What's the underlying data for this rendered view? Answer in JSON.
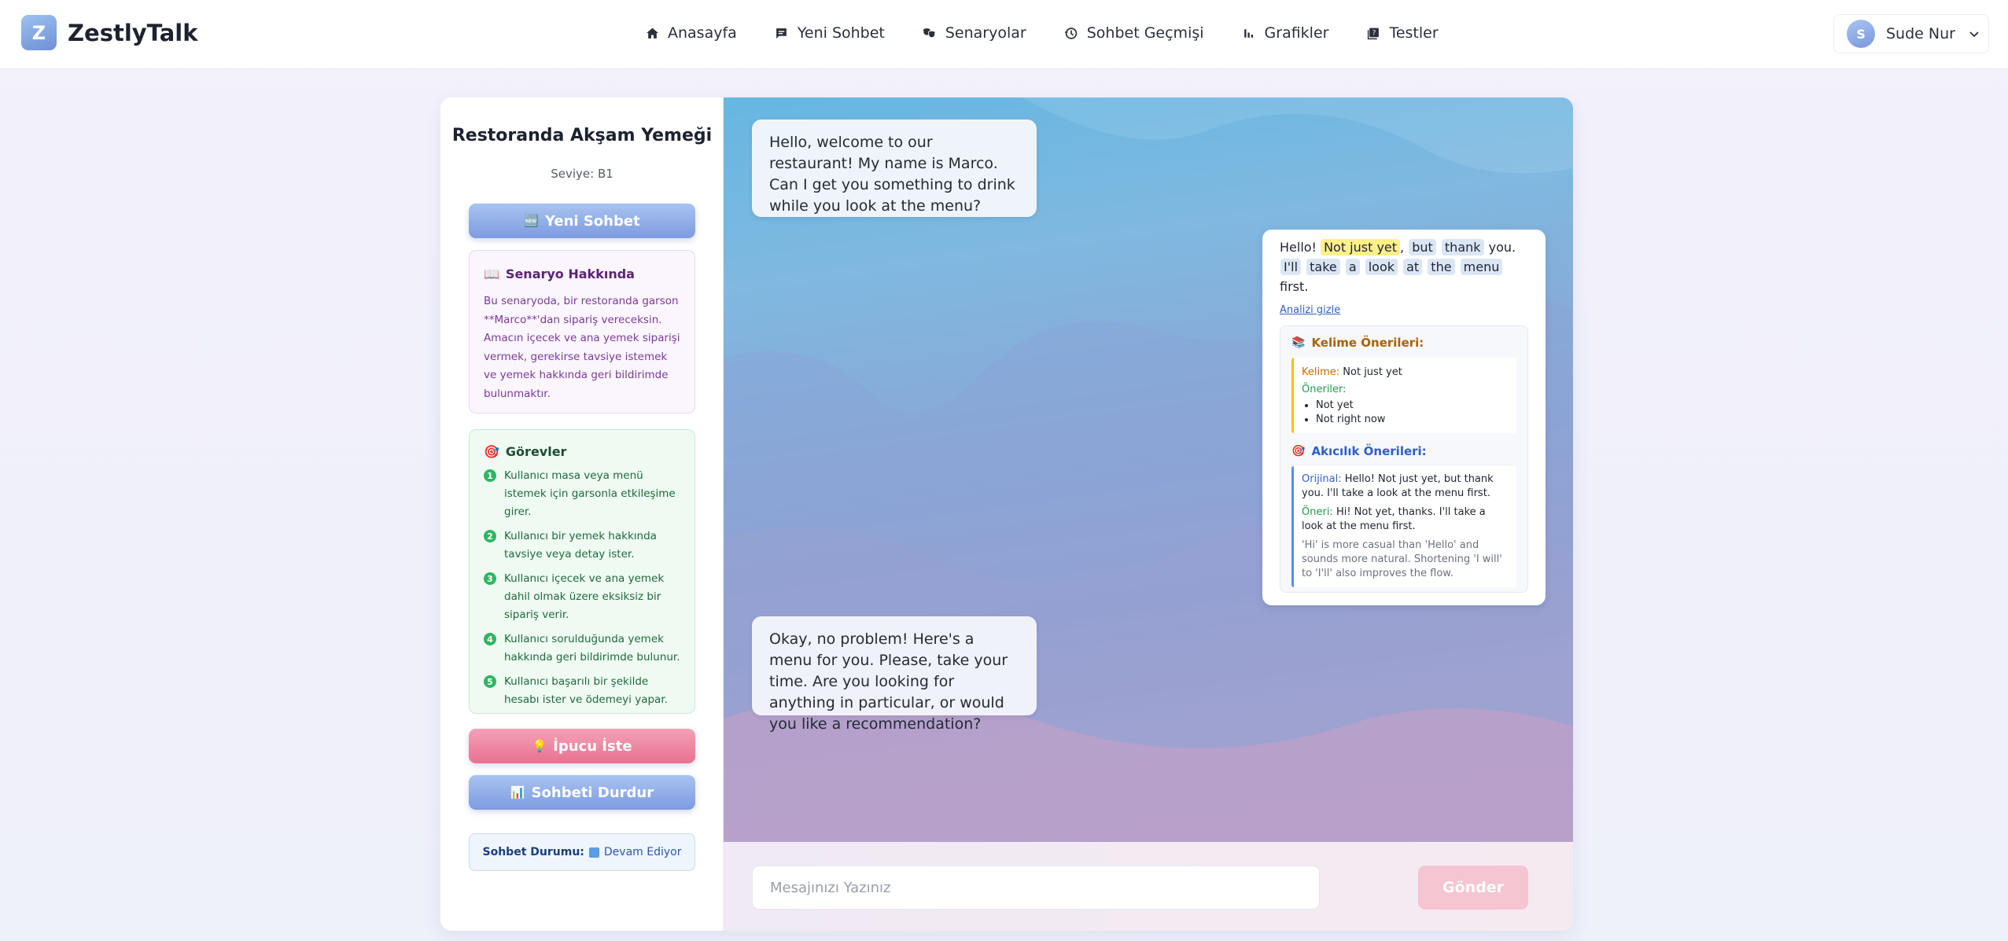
{
  "app": {
    "logo_letter": "Z",
    "name": "ZestlyTalk"
  },
  "nav": {
    "items": [
      {
        "label": "Anasayfa",
        "icon": "home-icon"
      },
      {
        "label": "Yeni Sohbet",
        "icon": "chat-icon"
      },
      {
        "label": "Senaryolar",
        "icon": "masks-icon"
      },
      {
        "label": "Sohbet Geçmişi",
        "icon": "history-icon"
      },
      {
        "label": "Grafikler",
        "icon": "bar-chart-icon"
      },
      {
        "label": "Testler",
        "icon": "quiz-icon"
      }
    ]
  },
  "user": {
    "initial": "S",
    "name": "Sude Nur"
  },
  "sidebar": {
    "title": "Restoranda Akşam Yemeği",
    "level": "Seviye: B1",
    "new_chat_icon": "🆕",
    "new_chat_label": "Yeni Sohbet",
    "about": {
      "icon": "📖",
      "title": "Senaryo Hakkında",
      "text": "Bu senaryoda, bir restoranda garson **Marco**'dan sipariş vereceksin. Amacın içecek ve ana yemek siparişi vermek, gerekirse tavsiye istemek ve yemek hakkında geri bildirimde bulunmaktır."
    },
    "tasks": {
      "icon": "🎯",
      "title": "Görevler",
      "items": [
        {
          "num": "1",
          "text": "Kullanıcı masa veya menü istemek için garsonla etkileşime girer."
        },
        {
          "num": "2",
          "text": "Kullanıcı bir yemek hakkında tavsiye veya detay ister."
        },
        {
          "num": "3",
          "text": "Kullanıcı içecek ve ana yemek dahil olmak üzere eksiksiz bir sipariş verir."
        },
        {
          "num": "4",
          "text": "Kullanıcı sorulduğunda yemek hakkında geri bildirimde bulunur."
        },
        {
          "num": "5",
          "text": "Kullanıcı başarılı bir şekilde hesabı ister ve ödemeyi yapar."
        }
      ]
    },
    "hint_icon": "💡",
    "hint_label": "İpucu İste",
    "stop_icon": "📊",
    "stop_label": "Sohbeti Durdur",
    "status_label": "Sohbet Durumu:",
    "status_value": "Devam Ediyor"
  },
  "chat": {
    "messages": [
      {
        "role": "bot",
        "text": "Hello, welcome to our restaurant! My name is Marco. Can I get you something to drink while you look at the menu?"
      },
      {
        "role": "user"
      },
      {
        "role": "bot",
        "text": "Okay, no problem! Here's a menu for you. Please, take your time. Are you looking for anything in particular, or would you like a recommendation?"
      }
    ],
    "user_message": {
      "t_hello": "Hello!",
      "t_notjustyet": "Not just yet",
      "t_comma": ",",
      "t_but": "but",
      "t_thank": "thank",
      "t_you": "you.",
      "t_ill": "I'll",
      "t_take": "take",
      "t_a": "a",
      "t_look": "look",
      "t_at": "at",
      "t_the": "the",
      "t_menu": "menu",
      "t_first": "first."
    },
    "hide_analysis": "Analizi gizle",
    "word_suggestions": {
      "icon": "📚",
      "title": "Kelime Önerileri:",
      "word_label": "Kelime:",
      "word": "Not just yet",
      "suggestions_label": "Öneriler:",
      "suggestions": [
        "Not yet",
        "Not right now"
      ]
    },
    "fluency_suggestions": {
      "icon": "🎯",
      "title": "Akıcılık Önerileri:",
      "original_label": "Orijinal:",
      "original": "Hello! Not just yet, but thank you. I'll take a look at the menu first.",
      "suggestion_label": "Öneri:",
      "suggestion": "Hi! Not yet, thanks. I'll take a look at the menu first.",
      "note": "'Hi' is more casual than 'Hello' and sounds more natural. Shortening 'I will' to 'I'll' also improves the flow."
    }
  },
  "composer": {
    "placeholder": "Mesajınızı Yazınız",
    "send_label": "Gönder"
  }
}
